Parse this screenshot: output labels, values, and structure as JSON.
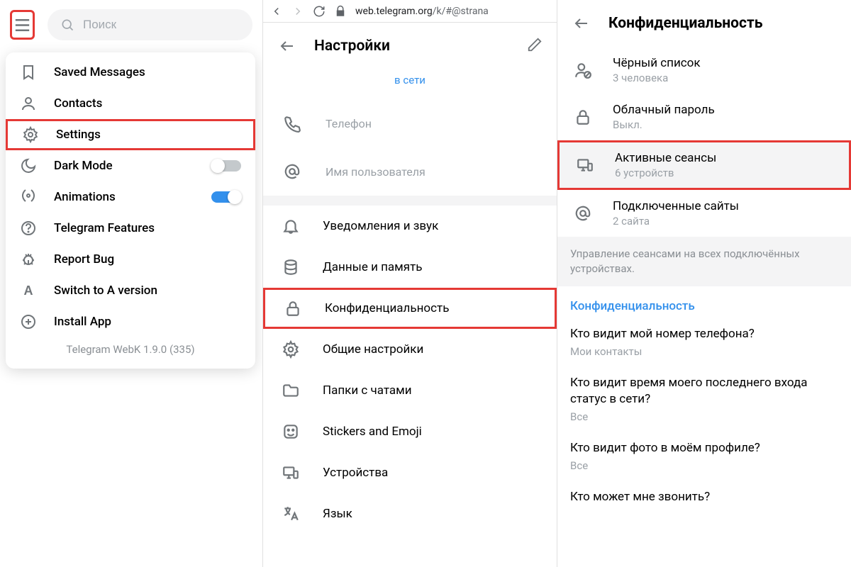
{
  "left": {
    "search_placeholder": "Поиск",
    "menu": [
      {
        "icon": "bookmark",
        "label": "Saved Messages"
      },
      {
        "icon": "person",
        "label": "Contacts"
      },
      {
        "icon": "gear",
        "label": "Settings",
        "highlight": true
      },
      {
        "icon": "moon",
        "label": "Dark Mode",
        "toggle": "off"
      },
      {
        "icon": "anim",
        "label": "Animations",
        "toggle": "on"
      },
      {
        "icon": "help",
        "label": "Telegram Features"
      },
      {
        "icon": "bug",
        "label": "Report Bug"
      },
      {
        "icon": "letterA",
        "label": "Switch to A version"
      },
      {
        "icon": "plus",
        "label": "Install App"
      }
    ],
    "version": "Telegram WebK 1.9.0 (335)"
  },
  "mid": {
    "url_prefix": "web.telegram.org",
    "url_suffix": "/k/#@strana",
    "title": "Настройки",
    "status": "в сети",
    "fields": [
      {
        "icon": "phone",
        "label": "Телефон"
      },
      {
        "icon": "at",
        "label": "Имя пользователя"
      }
    ],
    "settings": [
      {
        "icon": "bell",
        "label": "Уведомления и звук"
      },
      {
        "icon": "data",
        "label": "Данные и память"
      },
      {
        "icon": "lock",
        "label": "Конфиденциальность",
        "highlight": true
      },
      {
        "icon": "gear",
        "label": "Общие настройки"
      },
      {
        "icon": "folder",
        "label": "Папки с чатами"
      },
      {
        "icon": "sticker",
        "label": "Stickers and Emoji"
      },
      {
        "icon": "devices",
        "label": "Устройства"
      },
      {
        "icon": "lang",
        "label": "Язык"
      }
    ]
  },
  "right": {
    "title": "Конфиденциальность",
    "items": [
      {
        "icon": "blocklist",
        "label": "Чёрный список",
        "sub": "3 человека"
      },
      {
        "icon": "lock",
        "label": "Облачный пароль",
        "sub": "Выкл."
      },
      {
        "icon": "devices",
        "label": "Активные сеансы",
        "sub": "6 устройств",
        "highlight": true
      },
      {
        "icon": "at",
        "label": "Подключенные сайты",
        "sub": "2 сайта"
      }
    ],
    "info": "Управление сеансами на всех подключённых устройствах.",
    "section": "Конфиденциальность",
    "questions": [
      {
        "q": "Кто видит мой номер телефона?",
        "v": "Мои контакты"
      },
      {
        "q": "Кто видит время моего последнего входа статус в сети?",
        "v": "Все"
      },
      {
        "q": "Кто видит фото в моём профиле?",
        "v": "Все"
      },
      {
        "q": "Кто может мне звонить?",
        "v": ""
      }
    ]
  }
}
